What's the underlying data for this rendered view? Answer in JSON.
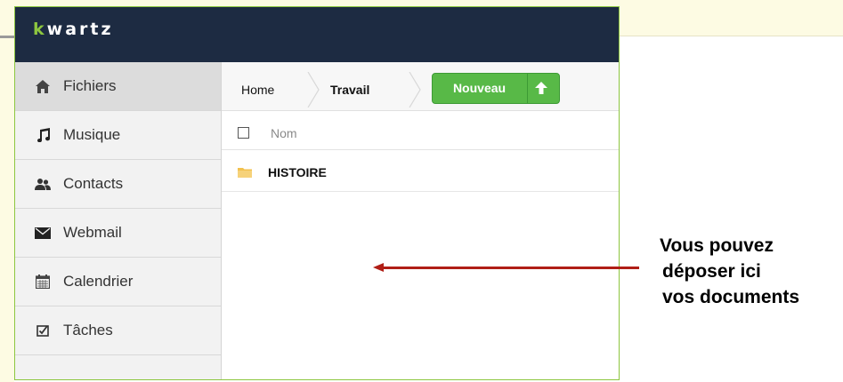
{
  "app": {
    "logo_mark": "k",
    "logo_rest": "wartz"
  },
  "sidebar": {
    "items": [
      {
        "label": "Fichiers",
        "icon": "home-icon"
      },
      {
        "label": "Musique",
        "icon": "music-note-icon"
      },
      {
        "label": "Contacts",
        "icon": "contacts-icon"
      },
      {
        "label": "Webmail",
        "icon": "envelope-icon"
      },
      {
        "label": "Calendrier",
        "icon": "calendar-icon"
      },
      {
        "label": "Tâches",
        "icon": "tasks-icon"
      }
    ]
  },
  "breadcrumb": {
    "home": "Home",
    "current": "Travail"
  },
  "toolbar": {
    "new_label": "Nouveau",
    "upload_icon": "upload-arrow-icon"
  },
  "file_list": {
    "column_name": "Nom",
    "rows": [
      {
        "name": "HISTOIRE",
        "icon": "folder-icon"
      }
    ]
  },
  "annotation": {
    "lines": [
      "Vous pouvez",
      "déposer ici",
      "vos documents"
    ]
  },
  "colors": {
    "topbar": "#1d2b42",
    "accent": "#8dc63f",
    "button_green": "#58b947",
    "arrow": "#b01e16"
  }
}
